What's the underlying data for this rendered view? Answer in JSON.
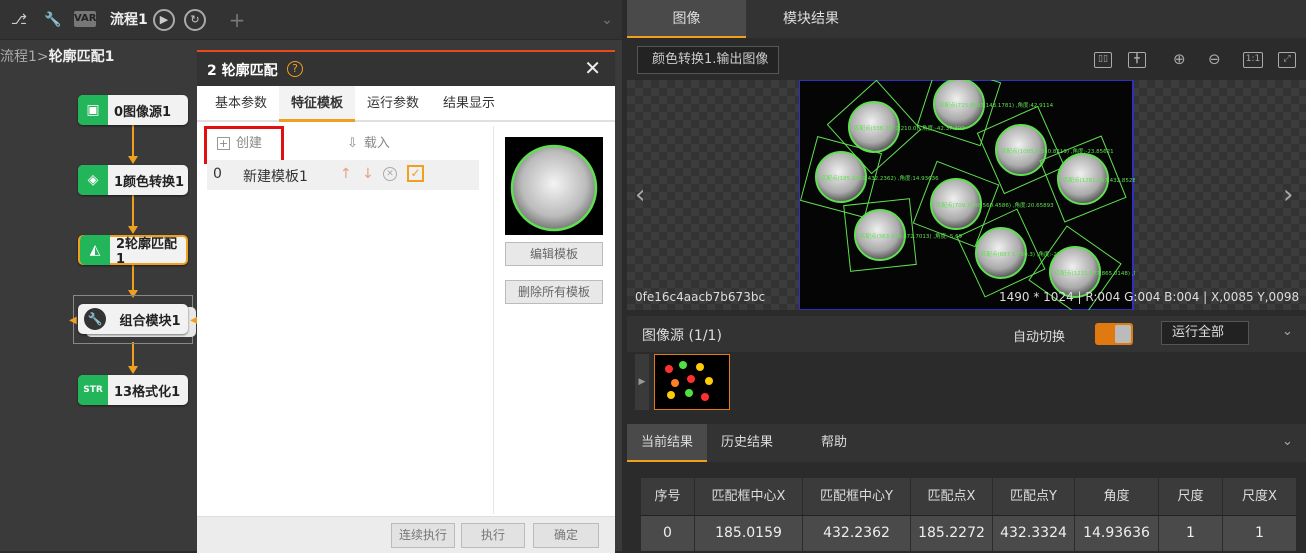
{
  "flow": {
    "tab_label": "流程1",
    "var_badge": "VAR",
    "breadcrumb_parent": "流程1",
    "breadcrumb_sep": ">",
    "breadcrumb_current": "轮廓匹配1",
    "nodes": [
      "0图像源1",
      "1颜色转换1",
      "2轮廓匹配1",
      "组合模块1",
      "13格式化1"
    ]
  },
  "dialog": {
    "title": "2 轮廓匹配",
    "help_glyph": "?",
    "close_glyph": "✕",
    "tabs": [
      "基本参数",
      "特征模板",
      "运行参数",
      "结果显示"
    ],
    "active_tab": 1,
    "create_label": "创建",
    "load_label": "载入",
    "template_row": {
      "index": "0",
      "name": "新建模板1",
      "checked": true
    },
    "edit_template": "编辑模板",
    "delete_all": "删除所有模板",
    "footer": {
      "continuous": "连续执行",
      "execute": "执行",
      "confirm": "确定"
    }
  },
  "right": {
    "tabs": [
      "图像",
      "模块结果"
    ],
    "image_select": "颜色转换1.输出图像",
    "image_id": "0fe16c4aacb7b673bc",
    "image_stats": "1490 * 1024  |  R:004  G:004  B:004  |  X,0085  Y,0098",
    "source_label": "图像源 (1/1)",
    "auto_switch_label": "自动切换",
    "auto_switch_on": true,
    "run_all": "运行全部",
    "bottom_tabs": [
      "当前结果",
      "历史结果",
      "帮助"
    ],
    "table": {
      "headers": [
        "序号",
        "匹配框中心X",
        "匹配框中心Y",
        "匹配点X",
        "匹配点Y",
        "角度",
        "尺度",
        "尺度X"
      ],
      "rows": [
        [
          "0",
          "185.0159",
          "432.2362",
          "185.2272",
          "432.3324",
          "14.93636",
          "1",
          "1"
        ]
      ]
    },
    "overlay_labels": [
      "匹配点(725.8893,143.1781) ,角度:42.9114",
      "匹配点(338.7572,210.0)  ,角度:-42.37.390",
      "匹配点(1085.6,350.8219) ,角度:-23.85621",
      "匹配点(185.0159,432.2362) ,角度:14.93636",
      "匹配点(1281.467,432.8528) ,角度:-22.08755",
      "匹配点(709.7046,560.4586) ,角度:20.65893",
      "匹配点(363.919,672.7013) ,角度:-5.69",
      "匹配点(887.5,750.3) ,角度:-25.38113",
      "匹配点(1231.977,865.0148) ,角度:34.70749"
    ]
  },
  "colors": {
    "accent": "#f0a020",
    "node_green": "#22b55a",
    "match_green": "#5fe050",
    "highlight_red": "#e01010",
    "toggle_orange": "#e07a10"
  },
  "icons": [
    "flow-icon",
    "wrench-icon",
    "play-icon",
    "loop-icon",
    "plus-icon",
    "chevron-down-icon",
    "help-icon",
    "close-icon",
    "add-icon",
    "import-icon",
    "arrow-up-icon",
    "arrow-down-icon",
    "delete-icon",
    "checkbox-icon",
    "layout-single-icon",
    "layout-grid-icon",
    "zoom-in-icon",
    "zoom-out-icon",
    "actual-size-icon",
    "fit-icon",
    "prev-icon",
    "next-icon"
  ]
}
